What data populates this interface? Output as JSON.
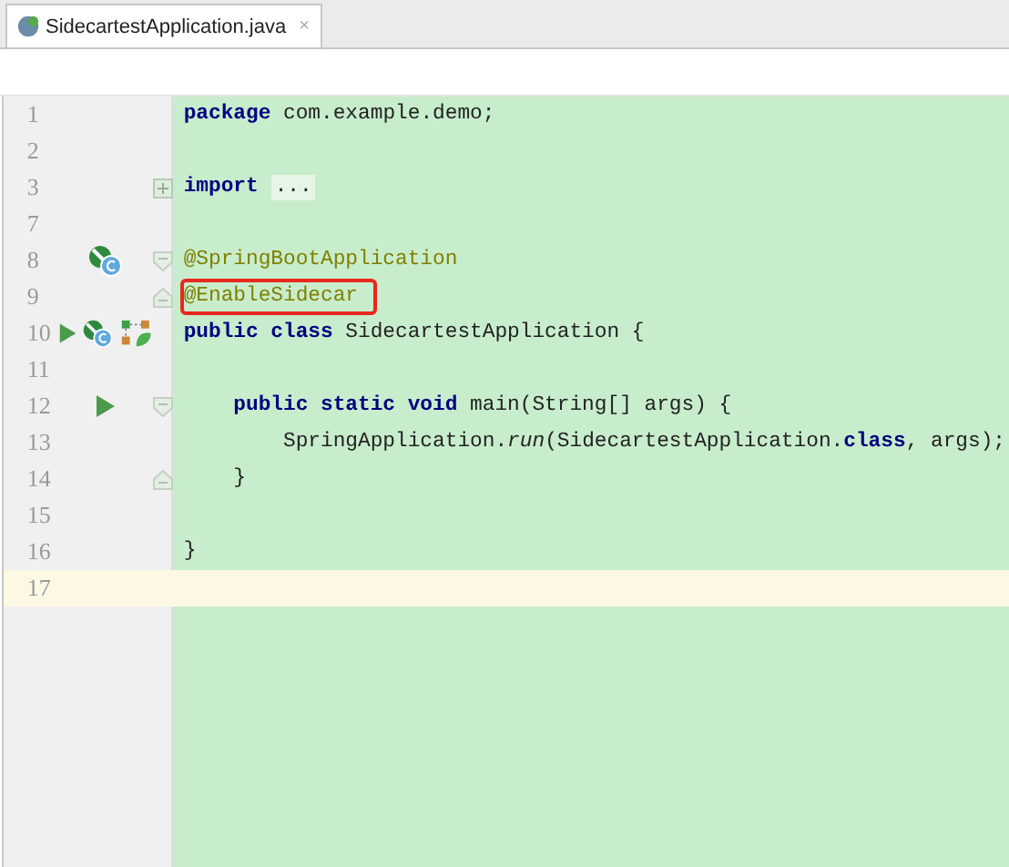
{
  "tab": {
    "title": "SidecartestApplication.java",
    "close": "×",
    "selected": true
  },
  "lines": [
    {
      "number": "1",
      "segments": [
        {
          "text": "package",
          "kind": "keyword"
        },
        {
          "text": " com.example.demo;",
          "kind": "plain"
        }
      ]
    },
    {
      "number": "2"
    },
    {
      "number": "3",
      "fold": {
        "kind": "collapsed"
      },
      "segments": [
        {
          "text": "import",
          "kind": "keyword"
        },
        {
          "text": "...",
          "kind": "folded"
        }
      ]
    },
    {
      "number": "7"
    },
    {
      "number": "8",
      "fold": {
        "kind": "start"
      },
      "markers": [
        {
          "kind": "bean"
        }
      ],
      "segments": [
        {
          "text": "@SpringBootApplication",
          "kind": "annotation"
        }
      ]
    },
    {
      "number": "9",
      "fold": {
        "kind": "end"
      },
      "highlighted": true,
      "segments": [
        {
          "text": "@EnableSidecar",
          "kind": "annotation"
        }
      ]
    },
    {
      "number": "10",
      "markers": [
        {
          "kind": "run"
        },
        {
          "kind": "bean"
        },
        {
          "kind": "diagram"
        }
      ],
      "segments": [
        {
          "text": "public class",
          "kind": "keyword"
        },
        {
          "text": " SidecartestApplication {",
          "kind": "plain"
        }
      ]
    },
    {
      "number": "11"
    },
    {
      "number": "12",
      "fold": {
        "kind": "start"
      },
      "markers": [
        {
          "kind": "run"
        }
      ],
      "segments": [
        {
          "text": "    public static void",
          "kind": "keyword"
        },
        {
          "text": " main(String[] args) {",
          "kind": "plain"
        }
      ]
    },
    {
      "number": "13",
      "segments": [
        {
          "text": "        SpringApplication.",
          "kind": "plain"
        },
        {
          "text": "run",
          "kind": "method"
        },
        {
          "text": "(SidecartestApplication.",
          "kind": "plain"
        },
        {
          "text": "class",
          "kind": "keyword"
        },
        {
          "text": ", args);",
          "kind": "plain"
        }
      ]
    },
    {
      "number": "14",
      "fold": {
        "kind": "end"
      },
      "segments": [
        {
          "text": "    }",
          "kind": "plain"
        }
      ]
    },
    {
      "number": "15"
    },
    {
      "number": "16",
      "segments": [
        {
          "text": "}",
          "kind": "plain"
        }
      ]
    },
    {
      "number": "17",
      "current": true
    }
  ]
}
